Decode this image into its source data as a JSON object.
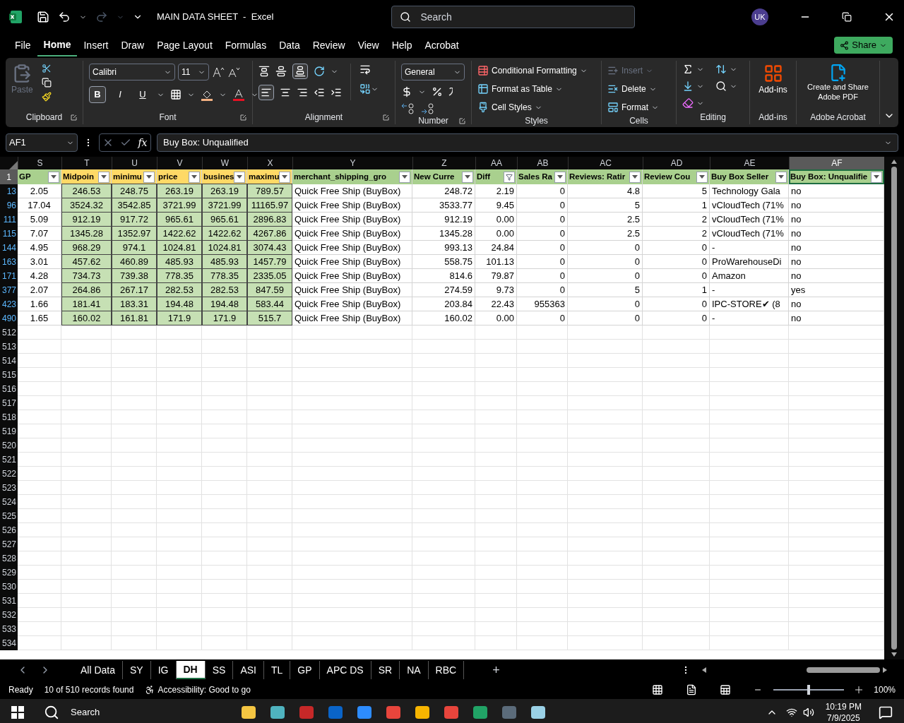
{
  "title_bar": {
    "title": "MAIN DATA SHEET  -  Excel",
    "search_placeholder": "Search",
    "avatar": "UK"
  },
  "menu_tabs": [
    {
      "label": "File",
      "selected": false
    },
    {
      "label": "Home",
      "selected": true
    },
    {
      "label": "Insert",
      "selected": false
    },
    {
      "label": "Draw",
      "selected": false
    },
    {
      "label": "Page Layout",
      "selected": false
    },
    {
      "label": "Formulas",
      "selected": false
    },
    {
      "label": "Data",
      "selected": false
    },
    {
      "label": "Review",
      "selected": false
    },
    {
      "label": "View",
      "selected": false
    },
    {
      "label": "Help",
      "selected": false
    },
    {
      "label": "Acrobat",
      "selected": false
    }
  ],
  "share_button": "Share",
  "ribbon": {
    "clipboard": {
      "paste": "Paste",
      "paste_disabled": true,
      "label": "Clipboard"
    },
    "font": {
      "name": "Calibri",
      "size": "11",
      "label": "Font",
      "styles": [
        {
          "label": "B",
          "selected": true
        },
        {
          "label": "I",
          "selected": false
        },
        {
          "label": "U",
          "selected": false
        }
      ]
    },
    "alignment": {
      "label": "Alignment"
    },
    "number": {
      "format": "General",
      "label": "Number"
    },
    "styles": {
      "items": [
        "Conditional Formatting",
        "Format as Table",
        "Cell Styles"
      ],
      "label": "Styles"
    },
    "cells": {
      "items": [
        {
          "label": "Insert",
          "disabled": true
        },
        {
          "label": "Delete",
          "disabled": false
        },
        {
          "label": "Format",
          "disabled": false
        }
      ],
      "label": "Cells"
    },
    "editing": {
      "label": "Editing"
    },
    "addins": {
      "button": "Add-ins",
      "label": "Add-ins"
    },
    "acrobat": {
      "button": "Create and Share Adobe PDF",
      "label": "Adobe Acrobat"
    }
  },
  "formula_bar": {
    "name_box": "AF1",
    "fx": "fx",
    "value": "Buy Box: Unqualified"
  },
  "sheet": {
    "header_row": "1",
    "columns": [
      {
        "letter": "S",
        "header": "GP",
        "color": "#a9d08e",
        "kind": "centered",
        "highlighted": false,
        "filtered": false,
        "selected": false
      },
      {
        "letter": "T",
        "header": "Midpoin",
        "color": "#ffd966",
        "kind": "centered",
        "highlighted": true,
        "filtered": false,
        "selected": false
      },
      {
        "letter": "U",
        "header": "minimu",
        "color": "#ffd966",
        "kind": "centered",
        "highlighted": true,
        "filtered": false,
        "selected": false
      },
      {
        "letter": "V",
        "header": "price",
        "color": "#ffd966",
        "kind": "centered",
        "highlighted": true,
        "filtered": false,
        "selected": false
      },
      {
        "letter": "W",
        "header": "busines",
        "color": "#ffd966",
        "kind": "centered",
        "highlighted": true,
        "filtered": false,
        "selected": false
      },
      {
        "letter": "X",
        "header": "maximu",
        "color": "#ffd966",
        "kind": "centered",
        "highlighted": true,
        "filtered": false,
        "selected": false
      },
      {
        "letter": "Y",
        "header": "merchant_shipping_gro",
        "color": "#a9d08e",
        "kind": "text",
        "highlighted": false,
        "filtered": false,
        "selected": false
      },
      {
        "letter": "Z",
        "header": "New Curre",
        "color": "#a9d08e",
        "kind": "number",
        "highlighted": false,
        "filtered": false,
        "selected": false
      },
      {
        "letter": "AA",
        "header": "Diff",
        "color": "#a9d08e",
        "kind": "number",
        "highlighted": false,
        "filtered": true,
        "selected": false
      },
      {
        "letter": "AB",
        "header": "Sales Ra",
        "color": "#a9d08e",
        "kind": "number",
        "highlighted": false,
        "filtered": false,
        "selected": false
      },
      {
        "letter": "AC",
        "header": "Reviews: Ratir",
        "color": "#a9d08e",
        "kind": "number",
        "highlighted": false,
        "filtered": false,
        "selected": false
      },
      {
        "letter": "AD",
        "header": "Review Cou",
        "color": "#a9d08e",
        "kind": "number",
        "highlighted": false,
        "filtered": false,
        "selected": false
      },
      {
        "letter": "AE",
        "header": "Buy Box Seller",
        "color": "#a9d08e",
        "kind": "text",
        "highlighted": false,
        "filtered": false,
        "selected": false
      },
      {
        "letter": "AF",
        "header": "Buy Box: Unqualifie",
        "color": "#a9d08e",
        "kind": "text",
        "highlighted": false,
        "filtered": false,
        "selected": true
      }
    ],
    "rows": [
      {
        "number": "13",
        "cells": [
          "2.05",
          "246.53",
          "248.75",
          "263.19",
          "263.19",
          "789.57",
          "Quick Free Ship (BuyBox)",
          "248.72",
          "2.19",
          "0",
          "4.8",
          "5",
          "Technology Gala",
          "no"
        ]
      },
      {
        "number": "96",
        "cells": [
          "17.04",
          "3524.32",
          "3542.85",
          "3721.99",
          "3721.99",
          "11165.97",
          "Quick Free Ship (BuyBox)",
          "3533.77",
          "9.45",
          "0",
          "5",
          "1",
          "vCloudTech (71%",
          "no"
        ]
      },
      {
        "number": "111",
        "cells": [
          "5.09",
          "912.19",
          "917.72",
          "965.61",
          "965.61",
          "2896.83",
          "Quick Free Ship (BuyBox)",
          "912.19",
          "0.00",
          "0",
          "2.5",
          "2",
          "vCloudTech (71%",
          "no"
        ]
      },
      {
        "number": "115",
        "cells": [
          "7.07",
          "1345.28",
          "1352.97",
          "1422.62",
          "1422.62",
          "4267.86",
          "Quick Free Ship (BuyBox)",
          "1345.28",
          "0.00",
          "0",
          "2.5",
          "2",
          "vCloudTech (71%",
          "no"
        ]
      },
      {
        "number": "144",
        "cells": [
          "4.95",
          "968.29",
          "974.1",
          "1024.81",
          "1024.81",
          "3074.43",
          "Quick Free Ship (BuyBox)",
          "993.13",
          "24.84",
          "0",
          "0",
          "0",
          "-",
          "no"
        ]
      },
      {
        "number": "163",
        "cells": [
          "3.01",
          "457.62",
          "460.89",
          "485.93",
          "485.93",
          "1457.79",
          "Quick Free Ship (BuyBox)",
          "558.75",
          "101.13",
          "0",
          "0",
          "0",
          "ProWarehouseDi",
          "no"
        ]
      },
      {
        "number": "171",
        "cells": [
          "4.28",
          "734.73",
          "739.38",
          "778.35",
          "778.35",
          "2335.05",
          "Quick Free Ship (BuyBox)",
          "814.6",
          "79.87",
          "0",
          "0",
          "0",
          "Amazon",
          "no"
        ]
      },
      {
        "number": "377",
        "cells": [
          "2.07",
          "264.86",
          "267.17",
          "282.53",
          "282.53",
          "847.59",
          "Quick Free Ship (BuyBox)",
          "274.59",
          "9.73",
          "0",
          "5",
          "1",
          "-",
          "yes"
        ]
      },
      {
        "number": "423",
        "cells": [
          "1.66",
          "181.41",
          "183.31",
          "194.48",
          "194.48",
          "583.44",
          "Quick Free Ship (BuyBox)",
          "203.84",
          "22.43",
          "955363",
          "0",
          "0",
          "IPC-STORE✔ (8",
          "no"
        ]
      },
      {
        "number": "490",
        "cells": [
          "1.65",
          "160.02",
          "161.81",
          "171.9",
          "171.9",
          "515.7",
          "Quick Free Ship (BuyBox)",
          "160.02",
          "0.00",
          "0",
          "0",
          "0",
          "-",
          "no"
        ]
      }
    ],
    "empty_rows": [
      "512",
      "513",
      "514",
      "515",
      "516",
      "517",
      "518",
      "519",
      "520",
      "521",
      "522",
      "523",
      "524",
      "525",
      "526",
      "527",
      "528",
      "529",
      "530",
      "531",
      "532",
      "533",
      "534"
    ]
  },
  "sheet_tabs": [
    {
      "label": "All Data",
      "selected": false
    },
    {
      "label": "SY",
      "selected": false
    },
    {
      "label": "IG",
      "selected": false
    },
    {
      "label": "DH",
      "selected": true
    },
    {
      "label": "SS",
      "selected": false
    },
    {
      "label": "ASI",
      "selected": false
    },
    {
      "label": "TL",
      "selected": false
    },
    {
      "label": "GP",
      "selected": false
    },
    {
      "label": "APC DS",
      "selected": false
    },
    {
      "label": "SR",
      "selected": false
    },
    {
      "label": "NA",
      "selected": false
    },
    {
      "label": "RBC",
      "selected": false
    }
  ],
  "add_sheet": "+",
  "status_bar": {
    "mode": "Ready",
    "records": "10 of 510 records found",
    "accessibility": "Accessibility: Good to go",
    "zoom_slider": {
      "level": 0.5
    },
    "zoom": "100%"
  },
  "taskbar": {
    "search": "Search",
    "time": "10:19 PM",
    "date": "7/9/2025"
  }
}
